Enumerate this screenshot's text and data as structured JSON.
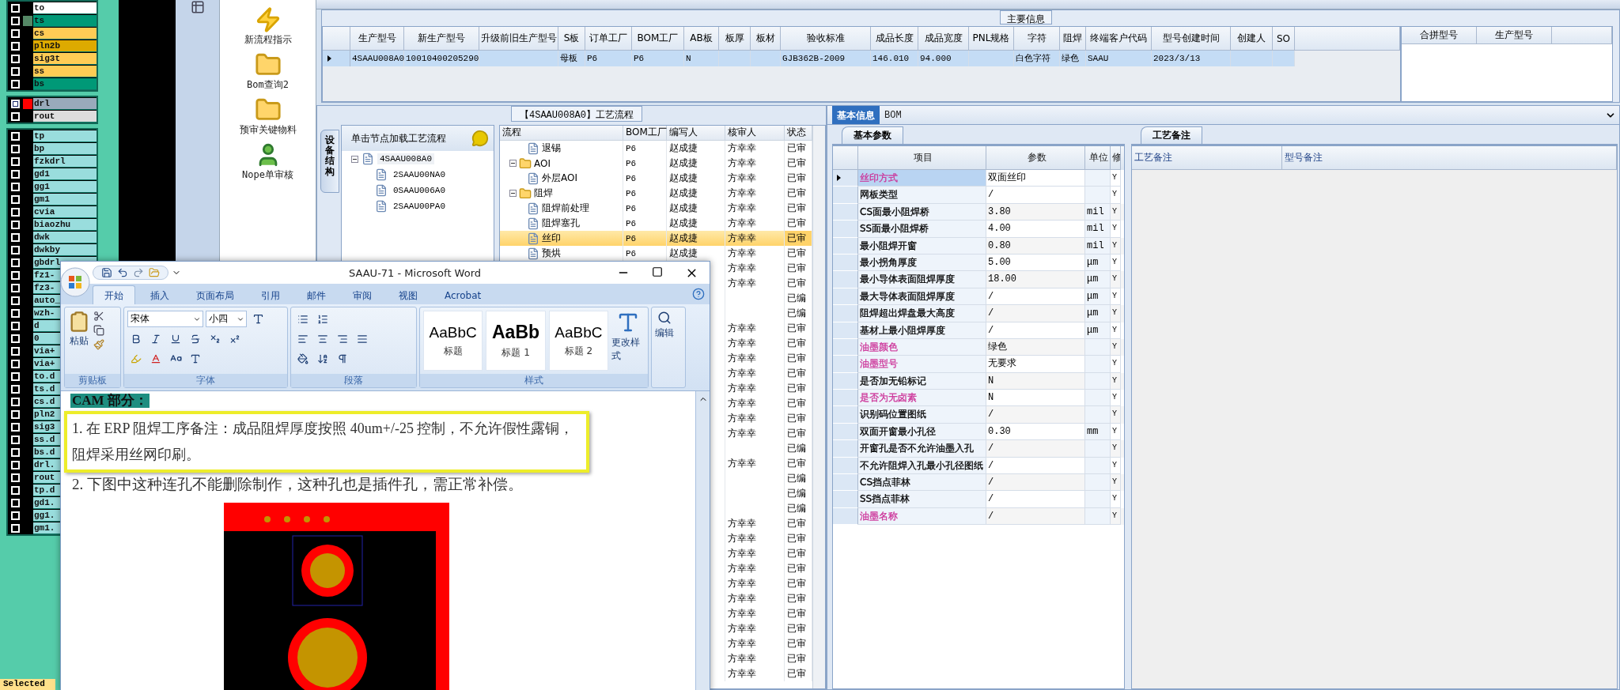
{
  "layer_groups": [
    {
      "layers": [
        {
          "label": "to",
          "color": "#ffffff",
          "checked": false
        },
        {
          "label": "ts",
          "color": "#009977",
          "swatch": {
            "color": "#558866"
          },
          "checked": false
        },
        {
          "label": "cs",
          "color": "#ffcc55",
          "checked": false
        },
        {
          "label": "pln2b",
          "color": "#ddaa00",
          "checked": false
        },
        {
          "label": "sig3t",
          "color": "#ffcc55",
          "checked": false
        },
        {
          "label": "ss",
          "color": "#ffcc55",
          "checked": false
        },
        {
          "label": "bs",
          "color": "#009977",
          "checked": false
        }
      ]
    },
    {
      "layers": [
        {
          "label": "drl",
          "color": "#99aabb",
          "swatch": {
            "color": "#ff0000"
          },
          "checked": true
        },
        {
          "label": "rout",
          "color": "#dddddd",
          "checked": false
        }
      ]
    },
    {
      "layers": [
        {
          "label": "tp",
          "color": "#99dddd",
          "checked": false
        },
        {
          "label": "bp",
          "color": "#99dddd",
          "checked": false
        },
        {
          "label": "fzkdrl",
          "color": "#99dddd",
          "checked": false
        },
        {
          "label": "gd1",
          "color": "#99dddd",
          "checked": false
        },
        {
          "label": "gg1",
          "color": "#99dddd",
          "checked": false
        },
        {
          "label": "gm1",
          "color": "#99dddd",
          "checked": false
        },
        {
          "label": "cvia",
          "color": "#99dddd",
          "checked": false
        },
        {
          "label": "biaozhu",
          "color": "#99dddd",
          "checked": false
        },
        {
          "label": "dwk",
          "color": "#99dddd",
          "checked": false
        },
        {
          "label": "dwkby",
          "color": "#99dddd",
          "checked": false
        },
        {
          "label": "gbdrl",
          "color": "#99dddd",
          "checked": false
        },
        {
          "label": "fz1-",
          "color": "#99dddd",
          "checked": false
        },
        {
          "label": "fz3-",
          "color": "#99dddd",
          "checked": false
        },
        {
          "label": "auto_",
          "color": "#99dddd",
          "checked": false
        },
        {
          "label": "wzh-",
          "color": "#99dddd",
          "checked": false
        },
        {
          "label": "d",
          "color": "#99dddd",
          "checked": false
        },
        {
          "label": "0",
          "color": "#99dddd",
          "checked": false
        },
        {
          "label": "via+",
          "color": "#99dddd",
          "checked": false
        },
        {
          "label": "via+",
          "color": "#99dddd",
          "checked": false
        },
        {
          "label": "to.d",
          "color": "#99dddd",
          "checked": false
        },
        {
          "label": "ts.d",
          "color": "#99dddd",
          "checked": false
        },
        {
          "label": "cs.d",
          "color": "#99dddd",
          "checked": false
        },
        {
          "label": "pln2",
          "color": "#99dddd",
          "checked": false
        },
        {
          "label": "sig3",
          "color": "#99dddd",
          "checked": false
        },
        {
          "label": "ss.d",
          "color": "#99dddd",
          "checked": false
        },
        {
          "label": "bs.d",
          "color": "#99dddd",
          "checked": false
        },
        {
          "label": "drl.",
          "color": "#99dddd",
          "checked": false
        },
        {
          "label": "rout",
          "color": "#99dddd",
          "checked": false
        },
        {
          "label": "tp.d",
          "color": "#99dddd",
          "checked": false
        },
        {
          "label": "gd1.",
          "color": "#99dddd",
          "checked": false
        },
        {
          "label": "gg1.",
          "color": "#99dddd",
          "checked": false
        },
        {
          "label": "gm1.",
          "color": "#99dddd",
          "checked": false
        }
      ]
    }
  ],
  "layer_status": "Selected",
  "launcher": [
    {
      "kind": "lightning",
      "label": "新流程指示"
    },
    {
      "kind": "folder",
      "label": "Bom查询2"
    },
    {
      "kind": "folder",
      "label": "预审关键物料"
    },
    {
      "kind": "person",
      "label": "Nope单审核"
    }
  ],
  "main_info": {
    "title": "主要信息",
    "columns": [
      "生产型号",
      "新生产型号",
      "升级前旧生产型号",
      "S板",
      "订单工厂",
      "BOM工厂",
      "AB板",
      "板厚",
      "板材",
      "验收标准",
      "成品长度",
      "成品宽度",
      "PNL规格",
      "字符",
      "阻焊",
      "终端客户代码",
      "型号创建时间",
      "创建人",
      "SO"
    ],
    "rows": [
      {
        "selected": true,
        "cells": [
          "4SAAU008A0",
          "10010400205290",
          "",
          "母板",
          "P6",
          "P6",
          "N",
          "",
          "",
          "GJB362B-2009",
          "146.010",
          "94.000",
          "",
          "白色字符",
          "绿色",
          "SAAU",
          "2023/3/13",
          "",
          ""
        ]
      }
    ],
    "merge_columns": [
      "合拼型号",
      "生产型号"
    ]
  },
  "process": {
    "title": "【4SAAU008A0】工艺流程",
    "side_tab": "设备结构",
    "tree_hint": "单击节点加载工艺流程",
    "tree": {
      "label": "4SAAU008A0",
      "expanded": true,
      "children": [
        {
          "label": "2SAAU00NA0"
        },
        {
          "label": "0SAAU006A0"
        },
        {
          "label": "2SAAU00PA0"
        }
      ]
    },
    "columns": [
      "流程",
      "BOM工厂",
      "编写人",
      "核审人",
      "状态"
    ],
    "rows": [
      {
        "kind": "step",
        "name": "退锡",
        "factory": "P6",
        "writer": "赵成捷",
        "reviewer": "方幸幸",
        "status": "已审",
        "selected": false
      },
      {
        "kind": "folder",
        "name": "AOI",
        "factory": "P6",
        "writer": "赵成捷",
        "reviewer": "方幸幸",
        "status": "已审",
        "selected": false,
        "expanded": true,
        "children": [
          {
            "kind": "step",
            "name": "外层AOI",
            "factory": "P6",
            "writer": "赵成捷",
            "reviewer": "方幸幸",
            "status": "已审",
            "selected": false
          }
        ]
      },
      {
        "kind": "folder",
        "name": "阻焊",
        "factory": "P6",
        "writer": "赵成捷",
        "reviewer": "方幸幸",
        "status": "已审",
        "selected": false,
        "expanded": true,
        "children": [
          {
            "kind": "step",
            "name": "阻焊前处理",
            "factory": "P6",
            "writer": "赵成捷",
            "reviewer": "方幸幸",
            "status": "已审",
            "selected": false
          },
          {
            "kind": "step",
            "name": "阻焊塞孔",
            "factory": "P6",
            "writer": "赵成捷",
            "reviewer": "方幸幸",
            "status": "已审",
            "selected": false
          },
          {
            "kind": "step",
            "name": "丝印",
            "factory": "P6",
            "writer": "赵成捷",
            "reviewer": "方幸幸",
            "status": "已审",
            "selected": true
          },
          {
            "kind": "step",
            "name": "预烘",
            "factory": "P6",
            "writer": "赵成捷",
            "reviewer": "方幸幸",
            "status": "已审",
            "selected": false
          }
        ]
      },
      {
        "kind": "step",
        "reviewer": "方幸幸",
        "status": "已审",
        "selected": false
      },
      {
        "kind": "step",
        "reviewer": "方幸幸",
        "status": "已审",
        "selected": false
      },
      {
        "kind": "step",
        "status": "已编",
        "selected": false
      },
      {
        "kind": "step",
        "status": "已编",
        "selected": false
      },
      {
        "kind": "step",
        "reviewer": "方幸幸",
        "status": "已审",
        "selected": false
      },
      {
        "kind": "step",
        "reviewer": "方幸幸",
        "status": "已审",
        "selected": false
      },
      {
        "kind": "step",
        "reviewer": "方幸幸",
        "status": "已审",
        "selected": false
      },
      {
        "kind": "step",
        "reviewer": "方幸幸",
        "status": "已审",
        "selected": false
      },
      {
        "kind": "step",
        "reviewer": "方幸幸",
        "status": "已审",
        "selected": false
      },
      {
        "kind": "step",
        "reviewer": "方幸幸",
        "status": "已审",
        "selected": false
      },
      {
        "kind": "step",
        "reviewer": "方幸幸",
        "status": "已审",
        "selected": false
      },
      {
        "kind": "step",
        "reviewer": "方幸幸",
        "status": "已审",
        "selected": false
      },
      {
        "kind": "step",
        "status": "已编",
        "selected": false
      },
      {
        "kind": "step",
        "reviewer": "方幸幸",
        "status": "已审",
        "selected": false
      },
      {
        "kind": "step",
        "status": "已编",
        "selected": false
      },
      {
        "kind": "step",
        "status": "已编",
        "selected": false
      },
      {
        "kind": "step",
        "status": "已编",
        "selected": false
      },
      {
        "kind": "step",
        "reviewer": "方幸幸",
        "status": "已审",
        "selected": false
      },
      {
        "kind": "step",
        "reviewer": "方幸幸",
        "status": "已审",
        "selected": false
      },
      {
        "kind": "step",
        "reviewer": "方幸幸",
        "status": "已审",
        "selected": false
      },
      {
        "kind": "step",
        "reviewer": "方幸幸",
        "status": "已审",
        "selected": false
      },
      {
        "kind": "step",
        "reviewer": "方幸幸",
        "status": "已审",
        "selected": false
      },
      {
        "kind": "step",
        "reviewer": "方幸幸",
        "status": "已审",
        "selected": false
      },
      {
        "kind": "step",
        "reviewer": "方幸幸",
        "status": "已审",
        "selected": false
      },
      {
        "kind": "step",
        "reviewer": "方幸幸",
        "status": "已审",
        "selected": false
      },
      {
        "kind": "step",
        "reviewer": "方幸幸",
        "status": "已审",
        "selected": false
      },
      {
        "kind": "step",
        "reviewer": "方幸幸",
        "status": "已审",
        "selected": false
      },
      {
        "kind": "step",
        "reviewer": "方幸幸",
        "status": "已审",
        "selected": false
      }
    ]
  },
  "info": {
    "tabs": [
      {
        "label": "基本信息",
        "selected": true
      },
      {
        "label": "BOM",
        "selected": false
      }
    ],
    "params_tab": "基本参数",
    "param_columns": [
      "项目",
      "参数",
      "单位",
      "修"
    ],
    "params": [
      {
        "item": "丝印方式",
        "value": "双面丝印",
        "flag": "Y",
        "color": "#cc3399",
        "selected": true
      },
      {
        "item": "网板类型",
        "value": "/",
        "flag": "Y",
        "selected": false
      },
      {
        "item": "CS面最小阻焊桥",
        "value": "3.80",
        "unit": "mil",
        "flag": "Y",
        "selected": false
      },
      {
        "item": "SS面最小阻焊桥",
        "value": "4.00",
        "unit": "mil",
        "flag": "Y",
        "selected": false
      },
      {
        "item": "最小阻焊开窗",
        "value": "0.80",
        "unit": "mil",
        "flag": "Y",
        "selected": false
      },
      {
        "item": "最小拐角厚度",
        "value": "5.00",
        "unit": "μm",
        "flag": "Y",
        "selected": false
      },
      {
        "item": "最小导体表面阻焊厚度",
        "value": "18.00",
        "unit": "μm",
        "flag": "Y",
        "selected": false
      },
      {
        "item": "最大导体表面阻焊厚度",
        "value": "/",
        "unit": "μm",
        "flag": "Y",
        "selected": false
      },
      {
        "item": "阻焊超出焊盘最大高度",
        "value": "/",
        "unit": "μm",
        "flag": "Y",
        "selected": false
      },
      {
        "item": "基材上最小阻焊厚度",
        "value": "/",
        "unit": "μm",
        "flag": "Y",
        "selected": false
      },
      {
        "item": "油墨颜色",
        "value": "绿色",
        "flag": "Y",
        "color": "#cc3399",
        "selected": false
      },
      {
        "item": "油墨型号",
        "value": "无要求",
        "flag": "Y",
        "color": "#cc3399",
        "selected": false
      },
      {
        "item": "是否加无铅标记",
        "value": "N",
        "flag": "Y",
        "selected": false
      },
      {
        "item": "是否为无卤素",
        "value": "N",
        "flag": "Y",
        "color": "#cc3399",
        "selected": false
      },
      {
        "item": "识别码位置图纸",
        "value": "/",
        "flag": "Y",
        "selected": false
      },
      {
        "item": "双面开窗最小孔径",
        "value": "0.30",
        "unit": "mm",
        "flag": "Y",
        "selected": false
      },
      {
        "item": "开窗孔是否不允许油墨入孔",
        "value": "/",
        "flag": "Y",
        "selected": false
      },
      {
        "item": "不允许阻焊入孔最小孔径图纸",
        "value": "/",
        "flag": "Y",
        "selected": false
      },
      {
        "item": "CS挡点菲林",
        "value": "/",
        "flag": "Y",
        "selected": false
      },
      {
        "item": "SS挡点菲林",
        "value": "/",
        "flag": "Y",
        "selected": false
      },
      {
        "item": "油墨名称",
        "value": "/",
        "flag": "Y",
        "color": "#cc3399",
        "selected": false
      }
    ],
    "remarks_tab": "工艺备注",
    "remark_columns": [
      "工艺备注",
      "型号备注"
    ]
  },
  "word": {
    "title": "SAAU-71 - Microsoft Word",
    "tabs": [
      {
        "label": "开始",
        "selected": true
      },
      {
        "label": "插入",
        "selected": false
      },
      {
        "label": "页面布局",
        "selected": false
      },
      {
        "label": "引用",
        "selected": false
      },
      {
        "label": "邮件",
        "selected": false
      },
      {
        "label": "审阅",
        "selected": false
      },
      {
        "label": "视图",
        "selected": false
      },
      {
        "label": "Acrobat",
        "selected": false
      }
    ],
    "paste": "粘贴",
    "clipboard_label": "剪贴板",
    "font_name": "宋体",
    "font_size": "小四",
    "font_label": "字体",
    "paragraph_label": "段落",
    "styles": [
      {
        "preview": "AaBbC",
        "name": "标题",
        "kind": "normal"
      },
      {
        "preview": "AaBb",
        "name": "标题 1",
        "kind": "bold"
      },
      {
        "preview": "AaBbC",
        "name": "标题 2",
        "kind": "normal"
      }
    ],
    "change_styles": "更改样式",
    "styles_label": "样式",
    "editing": "编辑",
    "heading": "CAM 部分：",
    "boxed_paragraph": "1. 在 ERP 阻焊工序备注：成品阻焊厚度按照 40um+/-25 控制，不允许假性露铜，阻焊采用丝网印刷。",
    "paragraph": "2. 下图中这种连孔不能删除制作，这种孔也是插件孔，需正常补偿。"
  }
}
